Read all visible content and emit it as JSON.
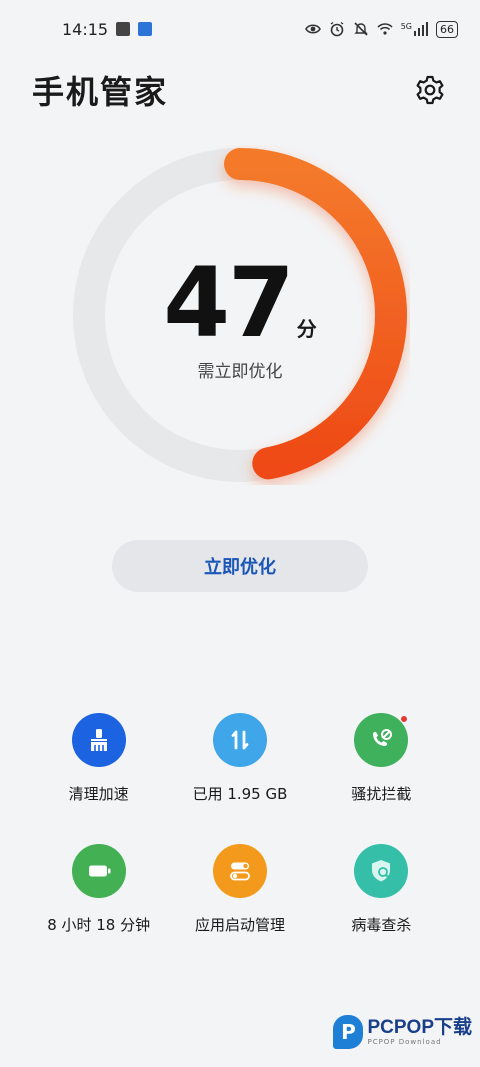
{
  "status_bar": {
    "time": "14:15",
    "network": "5G",
    "battery": "66",
    "icons": [
      "eye-icon",
      "alarm-icon",
      "mute-icon",
      "wifi-icon",
      "signal-icon",
      "battery-icon"
    ]
  },
  "header": {
    "title": "手机管家",
    "settings_icon": "gear-icon"
  },
  "score": {
    "value": "47",
    "unit": "分",
    "subtitle": "需立即优化",
    "max": 100,
    "progress_color": "#f2541c",
    "track_color": "#e7e8ea"
  },
  "action": {
    "optimize_label": "立即优化"
  },
  "tools": [
    {
      "label": "清理加速",
      "icon": "broom-icon",
      "color": "#1b63e0"
    },
    {
      "label": "已用 1.95 GB",
      "icon": "swap-arrows-icon",
      "color": "#3fa6ea"
    },
    {
      "label": "骚扰拦截",
      "icon": "blocked-call-icon",
      "color": "#3fb05c",
      "badge": true
    },
    {
      "label": "8 小时 18 分钟",
      "icon": "battery-icon",
      "color": "#43b153"
    },
    {
      "label": "应用启动管理",
      "icon": "toggles-icon",
      "color": "#f39a1c"
    },
    {
      "label": "病毒查杀",
      "icon": "shield-search-icon",
      "color": "#36bfa8"
    }
  ],
  "watermark": {
    "brand": "PCPOP下载",
    "sub": "PCPOP Download"
  }
}
